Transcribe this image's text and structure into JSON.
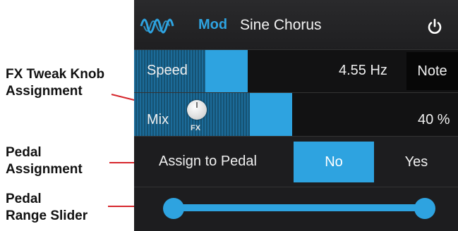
{
  "header": {
    "category": "Mod",
    "model": "Sine Chorus",
    "icons": {
      "model": "sine-wave-icon",
      "power": "power-icon"
    }
  },
  "params": {
    "speed": {
      "label": "Speed",
      "value": "4.55 Hz",
      "note_label": "Note",
      "level": 0.35
    },
    "mix": {
      "label": "Mix",
      "value": "40 %",
      "fx_tag": "FX",
      "level": 0.4
    }
  },
  "pedal": {
    "assign_label": "Assign to Pedal",
    "options": [
      "No",
      "Yes"
    ],
    "selected": "No",
    "range": [
      0,
      1
    ]
  },
  "callouts": {
    "fx_knob": "FX Tweak Knob\nAssignment",
    "pedal_assign": "Pedal\nAssignment",
    "pedal_range": "Pedal\nRange Slider"
  },
  "colors": {
    "accent": "#2ea3e0",
    "callout_line": "#d6262c"
  }
}
